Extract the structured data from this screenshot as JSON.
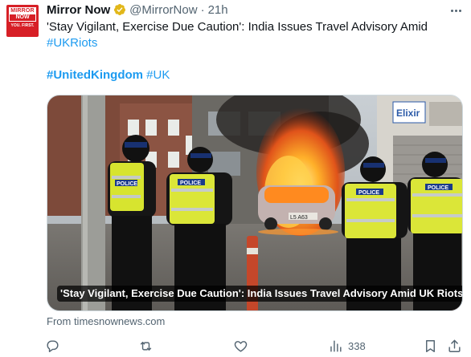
{
  "account": {
    "avatar_line1": "MIRROR",
    "avatar_line2": "NOW",
    "avatar_tagline": "YOU. FIRST.",
    "name": "Mirror Now",
    "handle": "@MirrorNow",
    "separator": "·",
    "time": "21h"
  },
  "tweet": {
    "text": "'Stay Vigilant, Exercise Due Caution': India Issues Travel Advisory Amid",
    "hashtag_inline": "#UKRiots",
    "hashtag_primary": "#UnitedKingdom",
    "hashtag_secondary": "#UK"
  },
  "card": {
    "caption": "'Stay Vigilant, Exercise Due Caution': India Issues Travel Advisory Amid UK Riots",
    "shop_sign": "Elixir",
    "vest_label": "POLICE",
    "plate": "L5 A63"
  },
  "source": "From timesnownews.com",
  "actions": {
    "reply_count": "",
    "retweet_count": "",
    "like_count": "",
    "views_count": "338"
  },
  "colors": {
    "link": "#1d9bf0",
    "muted": "#536471",
    "verified": "#e2b719",
    "brand_red": "#d71f26"
  }
}
